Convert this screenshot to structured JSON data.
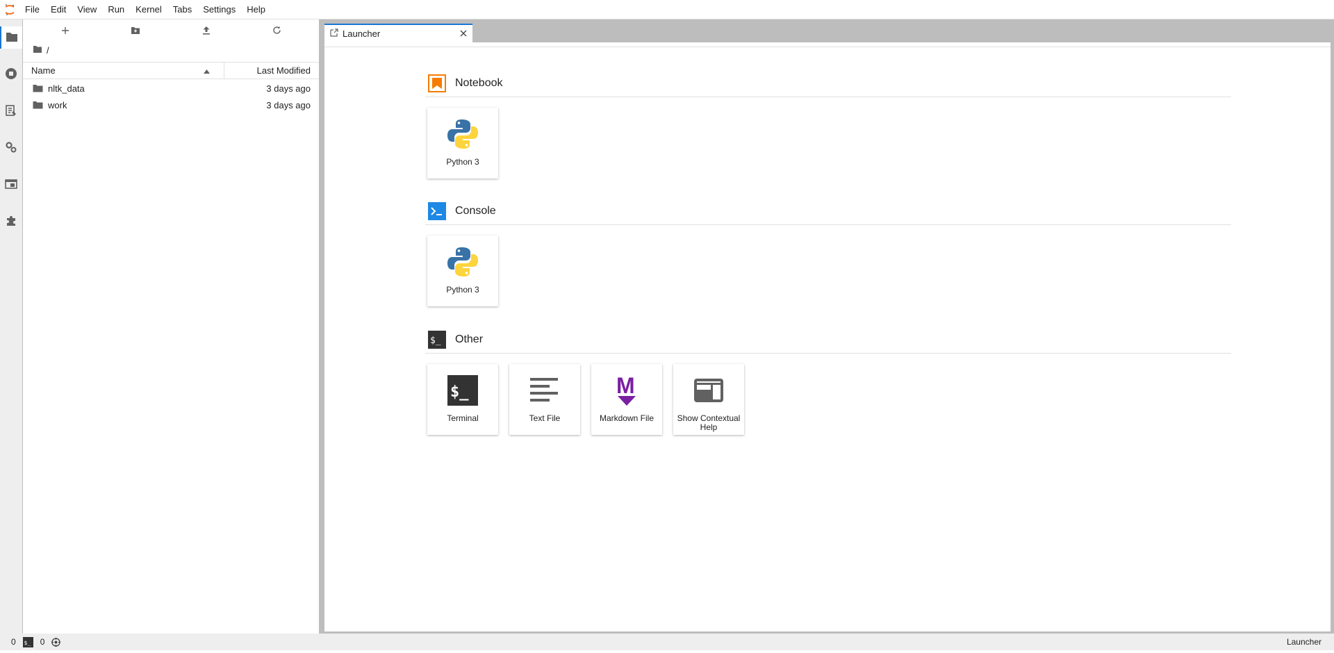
{
  "menubar": {
    "items": [
      "File",
      "Edit",
      "View",
      "Run",
      "Kernel",
      "Tabs",
      "Settings",
      "Help"
    ]
  },
  "activitybar": {
    "icons": [
      "folder-icon",
      "running-icon",
      "commands-icon",
      "property-inspector-icon",
      "tabs-icon",
      "extension-icon"
    ]
  },
  "filebrowser": {
    "breadcrumb": "/",
    "columns": {
      "name": "Name",
      "modified": "Last Modified"
    },
    "rows": [
      {
        "name": "nltk_data",
        "modified": "3 days ago"
      },
      {
        "name": "work",
        "modified": "3 days ago"
      }
    ]
  },
  "tabs": [
    {
      "label": "Launcher"
    }
  ],
  "launcher": {
    "sections": [
      {
        "title": "Notebook",
        "cards": [
          {
            "label": "Python 3"
          }
        ]
      },
      {
        "title": "Console",
        "cards": [
          {
            "label": "Python 3"
          }
        ]
      },
      {
        "title": "Other",
        "cards": [
          {
            "label": "Terminal"
          },
          {
            "label": "Text File"
          },
          {
            "label": "Markdown File"
          },
          {
            "label": "Show Contextual Help"
          }
        ]
      }
    ]
  },
  "statusbar": {
    "kernels": "0",
    "terminals": "0",
    "mode": "Launcher"
  },
  "colors": {
    "accent": "#1976d2",
    "notebook": "#f57c00",
    "console": "#1e88e5",
    "markdown": "#7b1fa2"
  }
}
